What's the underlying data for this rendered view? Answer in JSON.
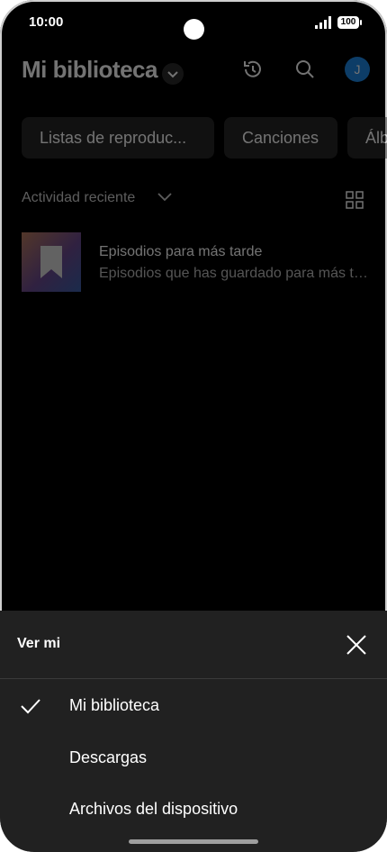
{
  "status_bar": {
    "time": "10:00",
    "battery": "100"
  },
  "header": {
    "title": "Mi biblioteca",
    "avatar_initial": "J"
  },
  "chips": [
    "Listas de reproduc...",
    "Canciones",
    "Álb"
  ],
  "sort": {
    "label": "Actividad reciente"
  },
  "library_items": [
    {
      "title": "Episodios para más tarde",
      "subtitle": "Episodios que has guardado para más tarde"
    }
  ],
  "sheet": {
    "title": "Ver mi",
    "options": [
      {
        "label": "Mi biblioteca",
        "selected": true
      },
      {
        "label": "Descargas",
        "selected": false
      },
      {
        "label": "Archivos del dispositivo",
        "selected": false
      }
    ]
  },
  "colors": {
    "background": "#000000",
    "sheet": "#212121",
    "avatar": "#1e88e5"
  }
}
